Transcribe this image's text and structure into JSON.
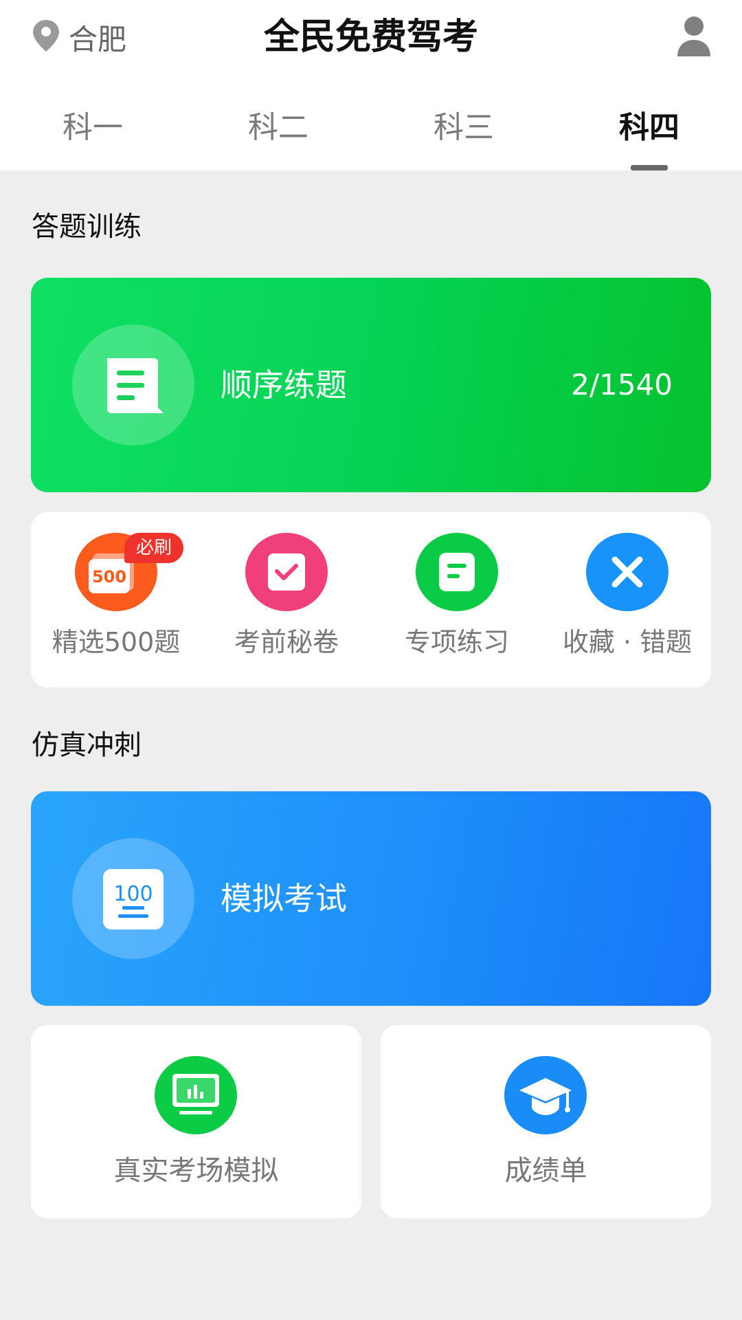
{
  "header": {
    "location": "合肥",
    "title": "全民免费驾考",
    "icons": {
      "location": "location-pin-icon",
      "user": "user-icon"
    }
  },
  "tabs": [
    {
      "label": "科一",
      "active": false
    },
    {
      "label": "科二",
      "active": false
    },
    {
      "label": "科三",
      "active": false
    },
    {
      "label": "科四",
      "active": true
    }
  ],
  "training": {
    "section_title": "答题训练",
    "sequential": {
      "label": "顺序练题",
      "progress": "2/1540",
      "icon": "document-icon"
    },
    "quick_items": [
      {
        "label": "精选500题",
        "badge": "必刷",
        "icon": "500-icon",
        "color": "#fb5b1c"
      },
      {
        "label": "考前秘卷",
        "icon": "check-icon",
        "color": "#f13f79"
      },
      {
        "label": "专项练习",
        "icon": "note-icon",
        "color": "#0acb46"
      },
      {
        "label": "收藏 · 错题",
        "icon": "close-icon",
        "color": "#1793f9"
      }
    ]
  },
  "sprint": {
    "section_title": "仿真冲刺",
    "mock_exam": {
      "label": "模拟考试",
      "icon": "score-100-icon"
    },
    "items": [
      {
        "label": "真实考场模拟",
        "icon": "monitor-chart-icon",
        "color": "#0ccb44"
      },
      {
        "label": "成绩单",
        "icon": "graduation-cap-icon",
        "color": "#1a8cf7"
      }
    ]
  }
}
